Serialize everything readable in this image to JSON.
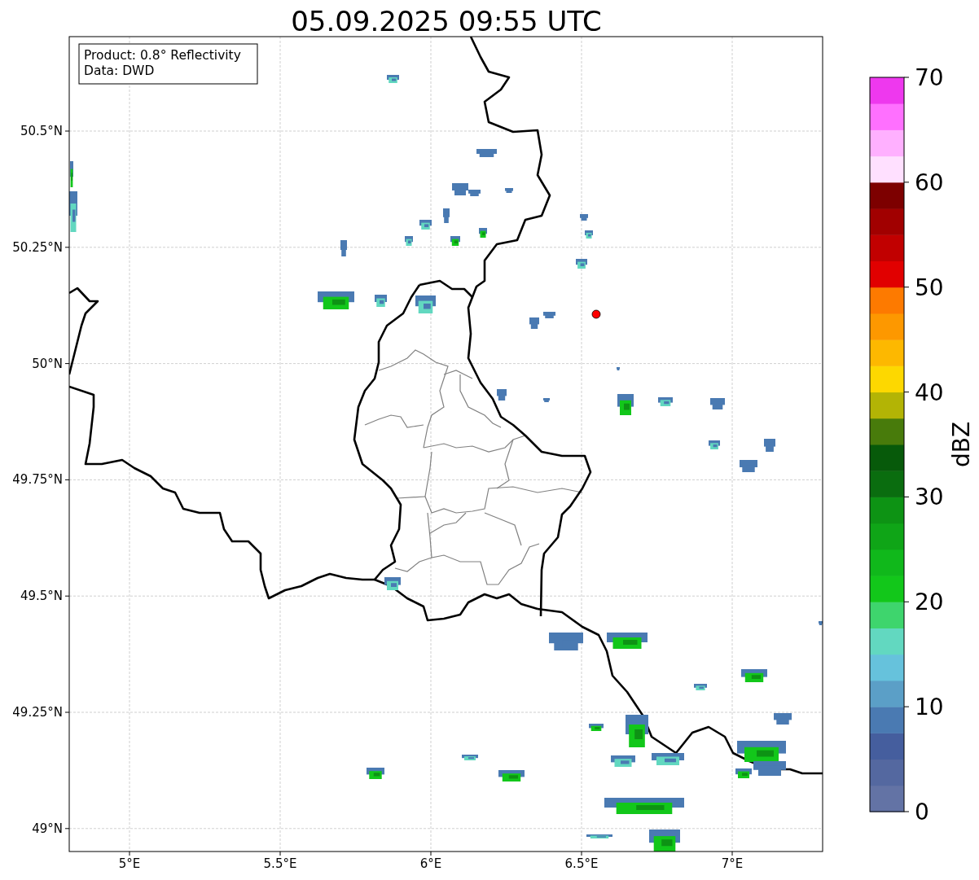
{
  "title": "05.09.2025 09:55 UTC",
  "info_box": [
    "Product: 0.8° Reflectivity",
    "Data: DWD"
  ],
  "x_axis": {
    "ticks": [
      "5°E",
      "5.5°E",
      "6°E",
      "6.5°E",
      "7°E"
    ]
  },
  "y_axis": {
    "ticks": [
      "50.5°N",
      "50.25°N",
      "50°N",
      "49.75°N",
      "49.5°N",
      "49.25°N",
      "49°N"
    ]
  },
  "colorbar": {
    "label": "dBZ",
    "ticks": [
      "70",
      "60",
      "50",
      "40",
      "30",
      "20",
      "10",
      "0"
    ],
    "segments": [
      {
        "color": "#6373a5"
      },
      {
        "color": "#5468a0"
      },
      {
        "color": "#455e9e"
      },
      {
        "color": "#4a7ab2"
      },
      {
        "color": "#5b9fc7"
      },
      {
        "color": "#66c2dc"
      },
      {
        "color": "#62d8c0"
      },
      {
        "color": "#3ed56d"
      },
      {
        "color": "#12c71a"
      },
      {
        "color": "#10b81b"
      },
      {
        "color": "#0fa517"
      },
      {
        "color": "#0d9314"
      },
      {
        "color": "#0a6d0f"
      },
      {
        "color": "#075a0a"
      },
      {
        "color": "#487b0b"
      },
      {
        "color": "#b3b405"
      },
      {
        "color": "#fdd800"
      },
      {
        "color": "#fdb800"
      },
      {
        "color": "#fd9800"
      },
      {
        "color": "#fd7a00"
      },
      {
        "color": "#e10000"
      },
      {
        "color": "#c10000"
      },
      {
        "color": "#a10000"
      },
      {
        "color": "#7d0000"
      },
      {
        "color": "#ffe0ff"
      },
      {
        "color": "#ffb0ff"
      },
      {
        "color": "#ff70ff"
      },
      {
        "color": "#ee38ee"
      }
    ]
  }
}
